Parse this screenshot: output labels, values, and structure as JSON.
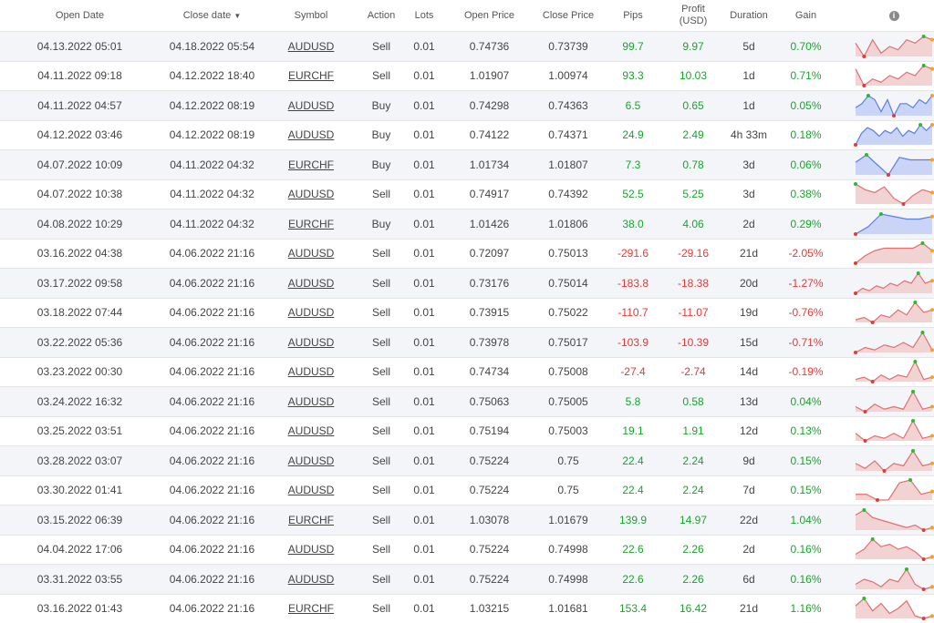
{
  "header": {
    "open_date": "Open Date",
    "close_date": "Close date",
    "symbol": "Symbol",
    "action": "Action",
    "lots": "Lots",
    "open_price": "Open Price",
    "close_price": "Close Price",
    "pips": "Pips",
    "profit_line1": "Profit",
    "profit_line2": "(USD)",
    "duration": "Duration",
    "gain": "Gain",
    "info_glyph": "i"
  },
  "colors": {
    "positive": "#1aa32c",
    "negative": "#e53935",
    "spark_up_line": "#5b7ee5",
    "spark_up_fill": "#c9d4f6",
    "spark_down_line": "#e07070",
    "spark_down_fill": "#f2d3d3",
    "marker_max": "#2eb82e",
    "marker_min": "#e53935",
    "marker_last": "#f0a030"
  },
  "trades": [
    {
      "open_date": "04.13.2022 05:01",
      "close_date": "04.18.2022 05:54",
      "symbol": "AUDUSD",
      "action": "Sell",
      "lots": "0.01",
      "open_price": "0.74736",
      "close_price": "0.73739",
      "pips": "99.7",
      "profit": "9.97",
      "duration": "5d",
      "gain": "0.70%",
      "trend": "down",
      "spark": [
        8,
        4,
        9,
        5,
        7,
        6,
        9,
        8,
        10,
        9
      ]
    },
    {
      "open_date": "04.11.2022 09:18",
      "close_date": "04.12.2022 18:40",
      "symbol": "EURCHF",
      "action": "Sell",
      "lots": "0.01",
      "open_price": "1.01907",
      "close_price": "1.00974",
      "pips": "93.3",
      "profit": "10.03",
      "duration": "1d",
      "gain": "0.71%",
      "trend": "down",
      "spark": [
        8,
        3,
        5,
        4,
        6,
        5,
        7,
        6,
        9,
        8
      ]
    },
    {
      "open_date": "04.11.2022 04:57",
      "close_date": "04.12.2022 08:19",
      "symbol": "AUDUSD",
      "action": "Buy",
      "lots": "0.01",
      "open_price": "0.74298",
      "close_price": "0.74363",
      "pips": "6.5",
      "profit": "0.65",
      "duration": "1d",
      "gain": "0.05%",
      "trend": "up",
      "spark": [
        6,
        7,
        9,
        8,
        5,
        8,
        4,
        7,
        7,
        6,
        8,
        7,
        9
      ]
    },
    {
      "open_date": "04.12.2022 03:46",
      "close_date": "04.12.2022 08:19",
      "symbol": "AUDUSD",
      "action": "Buy",
      "lots": "0.01",
      "open_price": "0.74122",
      "close_price": "0.74371",
      "pips": "24.9",
      "profit": "2.49",
      "duration": "4h 33m",
      "gain": "0.18%",
      "trend": "up",
      "spark": [
        2,
        6,
        8,
        7,
        5,
        7,
        6,
        8,
        5,
        7,
        6,
        9,
        7,
        9
      ]
    },
    {
      "open_date": "04.07.2022 10:09",
      "close_date": "04.11.2022 04:32",
      "symbol": "EURCHF",
      "action": "Buy",
      "lots": "0.01",
      "open_price": "1.01734",
      "close_price": "1.01807",
      "pips": "7.3",
      "profit": "0.78",
      "duration": "3d",
      "gain": "0.06%",
      "trend": "up",
      "spark": [
        6,
        9,
        5,
        1,
        8,
        7,
        7,
        7
      ]
    },
    {
      "open_date": "04.07.2022 10:38",
      "close_date": "04.11.2022 04:32",
      "symbol": "AUDUSD",
      "action": "Sell",
      "lots": "0.01",
      "open_price": "0.74917",
      "close_price": "0.74392",
      "pips": "52.5",
      "profit": "5.25",
      "duration": "3d",
      "gain": "0.38%",
      "trend": "down",
      "spark": [
        9,
        7,
        6,
        8,
        4,
        2,
        5,
        7,
        6
      ]
    },
    {
      "open_date": "04.08.2022 10:29",
      "close_date": "04.11.2022 04:32",
      "symbol": "EURCHF",
      "action": "Buy",
      "lots": "0.01",
      "open_price": "1.01426",
      "close_price": "1.01806",
      "pips": "38.0",
      "profit": "4.06",
      "duration": "2d",
      "gain": "0.29%",
      "trend": "up",
      "spark": [
        1,
        4,
        9,
        8,
        7,
        7,
        8
      ]
    },
    {
      "open_date": "03.16.2022 04:38",
      "close_date": "04.06.2022 21:16",
      "symbol": "AUDUSD",
      "action": "Sell",
      "lots": "0.01",
      "open_price": "0.72097",
      "close_price": "0.75013",
      "pips": "-291.6",
      "profit": "-29.16",
      "duration": "21d",
      "gain": "-2.05%",
      "trend": "down",
      "spark": [
        1,
        4,
        6,
        7,
        7,
        7,
        7,
        9,
        6
      ]
    },
    {
      "open_date": "03.17.2022 09:58",
      "close_date": "04.06.2022 21:16",
      "symbol": "AUDUSD",
      "action": "Sell",
      "lots": "0.01",
      "open_price": "0.73176",
      "close_price": "0.75014",
      "pips": "-183.8",
      "profit": "-18.38",
      "duration": "20d",
      "gain": "-1.27%",
      "trend": "down",
      "spark": [
        1,
        3,
        2,
        4,
        3,
        5,
        4,
        6,
        5,
        9,
        5,
        6
      ]
    },
    {
      "open_date": "03.18.2022 07:44",
      "close_date": "04.06.2022 21:16",
      "symbol": "AUDUSD",
      "action": "Sell",
      "lots": "0.01",
      "open_price": "0.73915",
      "close_price": "0.75022",
      "pips": "-110.7",
      "profit": "-11.07",
      "duration": "19d",
      "gain": "-0.76%",
      "trend": "down",
      "spark": [
        2,
        3,
        1,
        4,
        3,
        6,
        4,
        9,
        5,
        6
      ]
    },
    {
      "open_date": "03.22.2022 05:36",
      "close_date": "04.06.2022 21:16",
      "symbol": "AUDUSD",
      "action": "Sell",
      "lots": "0.01",
      "open_price": "0.73978",
      "close_price": "0.75017",
      "pips": "-103.9",
      "profit": "-10.39",
      "duration": "15d",
      "gain": "-0.71%",
      "trend": "down",
      "spark": [
        1,
        3,
        2,
        4,
        3,
        5,
        3,
        9,
        2
      ]
    },
    {
      "open_date": "03.23.2022 00:30",
      "close_date": "04.06.2022 21:16",
      "symbol": "AUDUSD",
      "action": "Sell",
      "lots": "0.01",
      "open_price": "0.74734",
      "close_price": "0.75008",
      "pips": "-27.4",
      "profit": "-2.74",
      "duration": "14d",
      "gain": "-0.19%",
      "trend": "down",
      "spark": [
        2,
        3,
        1,
        4,
        2,
        4,
        3,
        10,
        2,
        3
      ]
    },
    {
      "open_date": "03.24.2022 16:32",
      "close_date": "04.06.2022 21:16",
      "symbol": "AUDUSD",
      "action": "Sell",
      "lots": "0.01",
      "open_price": "0.75063",
      "close_price": "0.75005",
      "pips": "5.8",
      "profit": "0.58",
      "duration": "13d",
      "gain": "0.04%",
      "trend": "down",
      "spark": [
        3,
        1,
        4,
        2,
        3,
        2,
        9,
        2,
        3
      ]
    },
    {
      "open_date": "03.25.2022 03:51",
      "close_date": "04.06.2022 21:16",
      "symbol": "AUDUSD",
      "action": "Sell",
      "lots": "0.01",
      "open_price": "0.75194",
      "close_price": "0.75003",
      "pips": "19.1",
      "profit": "1.91",
      "duration": "12d",
      "gain": "0.13%",
      "trend": "down",
      "spark": [
        4,
        1,
        3,
        2,
        4,
        2,
        9,
        2,
        3
      ]
    },
    {
      "open_date": "03.28.2022 03:07",
      "close_date": "04.06.2022 21:16",
      "symbol": "AUDUSD",
      "action": "Sell",
      "lots": "0.01",
      "open_price": "0.75224",
      "close_price": "0.75",
      "pips": "22.4",
      "profit": "2.24",
      "duration": "9d",
      "gain": "0.15%",
      "trend": "down",
      "spark": [
        4,
        2,
        5,
        1,
        4,
        3,
        9,
        3,
        4
      ]
    },
    {
      "open_date": "03.30.2022 01:41",
      "close_date": "04.06.2022 21:16",
      "symbol": "AUDUSD",
      "action": "Sell",
      "lots": "0.01",
      "open_price": "0.75224",
      "close_price": "0.75",
      "pips": "22.4",
      "profit": "2.24",
      "duration": "7d",
      "gain": "0.15%",
      "trend": "down",
      "spark": [
        3,
        3,
        1,
        1,
        7,
        8,
        3,
        4
      ]
    },
    {
      "open_date": "03.15.2022 06:39",
      "close_date": "04.06.2022 21:16",
      "symbol": "EURCHF",
      "action": "Sell",
      "lots": "0.01",
      "open_price": "1.03078",
      "close_price": "1.01679",
      "pips": "139.9",
      "profit": "14.97",
      "duration": "22d",
      "gain": "1.04%",
      "trend": "down",
      "spark": [
        7,
        9,
        6,
        5,
        4,
        3,
        2,
        3,
        1,
        2
      ]
    },
    {
      "open_date": "04.04.2022 17:06",
      "close_date": "04.06.2022 21:16",
      "symbol": "AUDUSD",
      "action": "Sell",
      "lots": "0.01",
      "open_price": "0.75224",
      "close_price": "0.74998",
      "pips": "22.6",
      "profit": "2.26",
      "duration": "2d",
      "gain": "0.16%",
      "trend": "down",
      "spark": [
        3,
        5,
        9,
        6,
        7,
        5,
        6,
        4,
        1,
        2
      ]
    },
    {
      "open_date": "03.31.2022 03:55",
      "close_date": "04.06.2022 21:16",
      "symbol": "AUDUSD",
      "action": "Sell",
      "lots": "0.01",
      "open_price": "0.75224",
      "close_price": "0.74998",
      "pips": "22.6",
      "profit": "2.26",
      "duration": "6d",
      "gain": "0.16%",
      "trend": "down",
      "spark": [
        3,
        5,
        4,
        2,
        5,
        4,
        9,
        3,
        1,
        2
      ]
    },
    {
      "open_date": "03.16.2022 01:43",
      "close_date": "04.06.2022 21:16",
      "symbol": "EURCHF",
      "action": "Sell",
      "lots": "0.01",
      "open_price": "1.03215",
      "close_price": "1.01681",
      "pips": "153.4",
      "profit": "16.42",
      "duration": "21d",
      "gain": "1.16%",
      "trend": "down",
      "spark": [
        6,
        9,
        4,
        7,
        3,
        5,
        8,
        2,
        1,
        2
      ]
    }
  ]
}
